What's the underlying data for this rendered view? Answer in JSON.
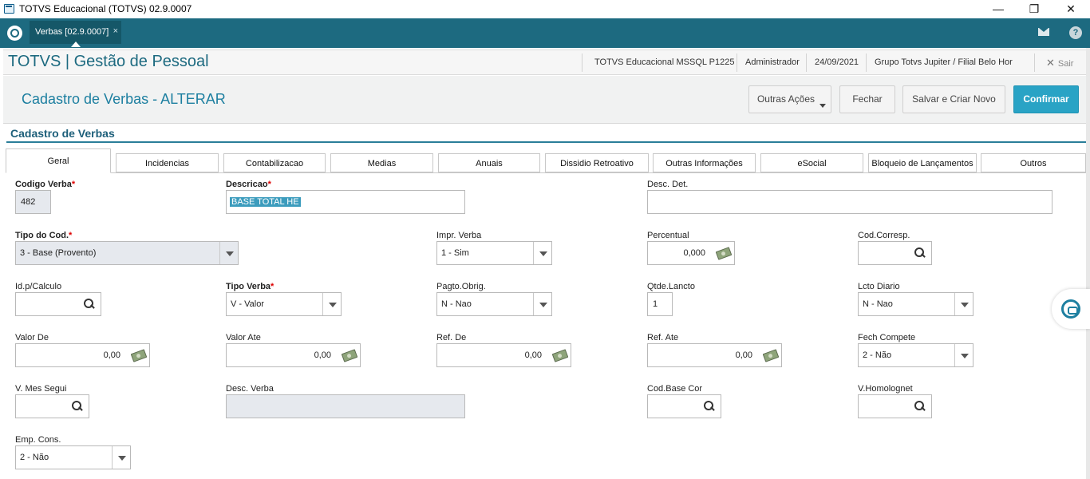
{
  "window": {
    "title": "TOTVS Educacional (TOTVS) 02.9.0007",
    "minimize": "—",
    "restore": "❐",
    "close": "✕"
  },
  "topbar": {
    "tab_label": "Verbas [02.9.0007]",
    "tab_close": "×",
    "help": "?"
  },
  "header": {
    "app_name": "TOTVS | Gestão de Pessoal",
    "environment": "TOTVS Educacional MSSQL P1225",
    "user": "Administrador",
    "date": "24/09/2021",
    "company": "Grupo Totvs Jupiter / Filial Belo Hor",
    "exit_icon": "✕",
    "exit_label": "Sair"
  },
  "page": {
    "title": "Cadastro de Verbas - ALTERAR",
    "buttons": {
      "other_actions": "Outras Ações",
      "close": "Fechar",
      "save_new": "Salvar e Criar Novo",
      "confirm": "Confirmar"
    }
  },
  "section": {
    "title": "Cadastro de Verbas"
  },
  "tabs": [
    "Geral",
    "Incidencias",
    "Contabilizacao",
    "Medias",
    "Anuais",
    "Dissidio Retroativo",
    "Outras Informações",
    "eSocial",
    "Bloqueio de Lançamentos",
    "Outros"
  ],
  "form": {
    "codigo_verba": {
      "label": "Codigo Verba",
      "value": "482"
    },
    "descricao": {
      "label": "Descricao",
      "value": "BASE TOTAL HE"
    },
    "desc_det": {
      "label": "Desc. Det.",
      "value": ""
    },
    "tipo_cod": {
      "label": "Tipo do Cod.",
      "value": "3 - Base (Provento)"
    },
    "impr_verba": {
      "label": "Impr. Verba",
      "value": "1 - Sim"
    },
    "percentual": {
      "label": "Percentual",
      "value": "0,000"
    },
    "cod_corresp": {
      "label": "Cod.Corresp.",
      "value": ""
    },
    "id_calculo": {
      "label": "Id.p/Calculo",
      "value": ""
    },
    "tipo_verba": {
      "label": "Tipo Verba",
      "value": "V - Valor"
    },
    "pagto_obrig": {
      "label": "Pagto.Obrig.",
      "value": "N - Nao"
    },
    "qtde_lancto": {
      "label": "Qtde.Lancto",
      "value": "1"
    },
    "lcto_diario": {
      "label": "Lcto Diario",
      "value": "N - Nao"
    },
    "valor_de": {
      "label": "Valor De",
      "value": "0,00"
    },
    "valor_ate": {
      "label": "Valor Ate",
      "value": "0,00"
    },
    "ref_de": {
      "label": "Ref. De",
      "value": "0,00"
    },
    "ref_ate": {
      "label": "Ref. Ate",
      "value": "0,00"
    },
    "fech_compete": {
      "label": "Fech Compete",
      "value": "2 - Não"
    },
    "v_mes_segui": {
      "label": "V. Mes Segui",
      "value": ""
    },
    "desc_verba": {
      "label": "Desc. Verba",
      "value": ""
    },
    "cod_base_cor": {
      "label": "Cod.Base Cor",
      "value": ""
    },
    "v_homolognet": {
      "label": "V.Homolognet",
      "value": ""
    },
    "emp_cons": {
      "label": "Emp. Cons.",
      "value": "2 - Não"
    }
  },
  "required_mark": "*"
}
